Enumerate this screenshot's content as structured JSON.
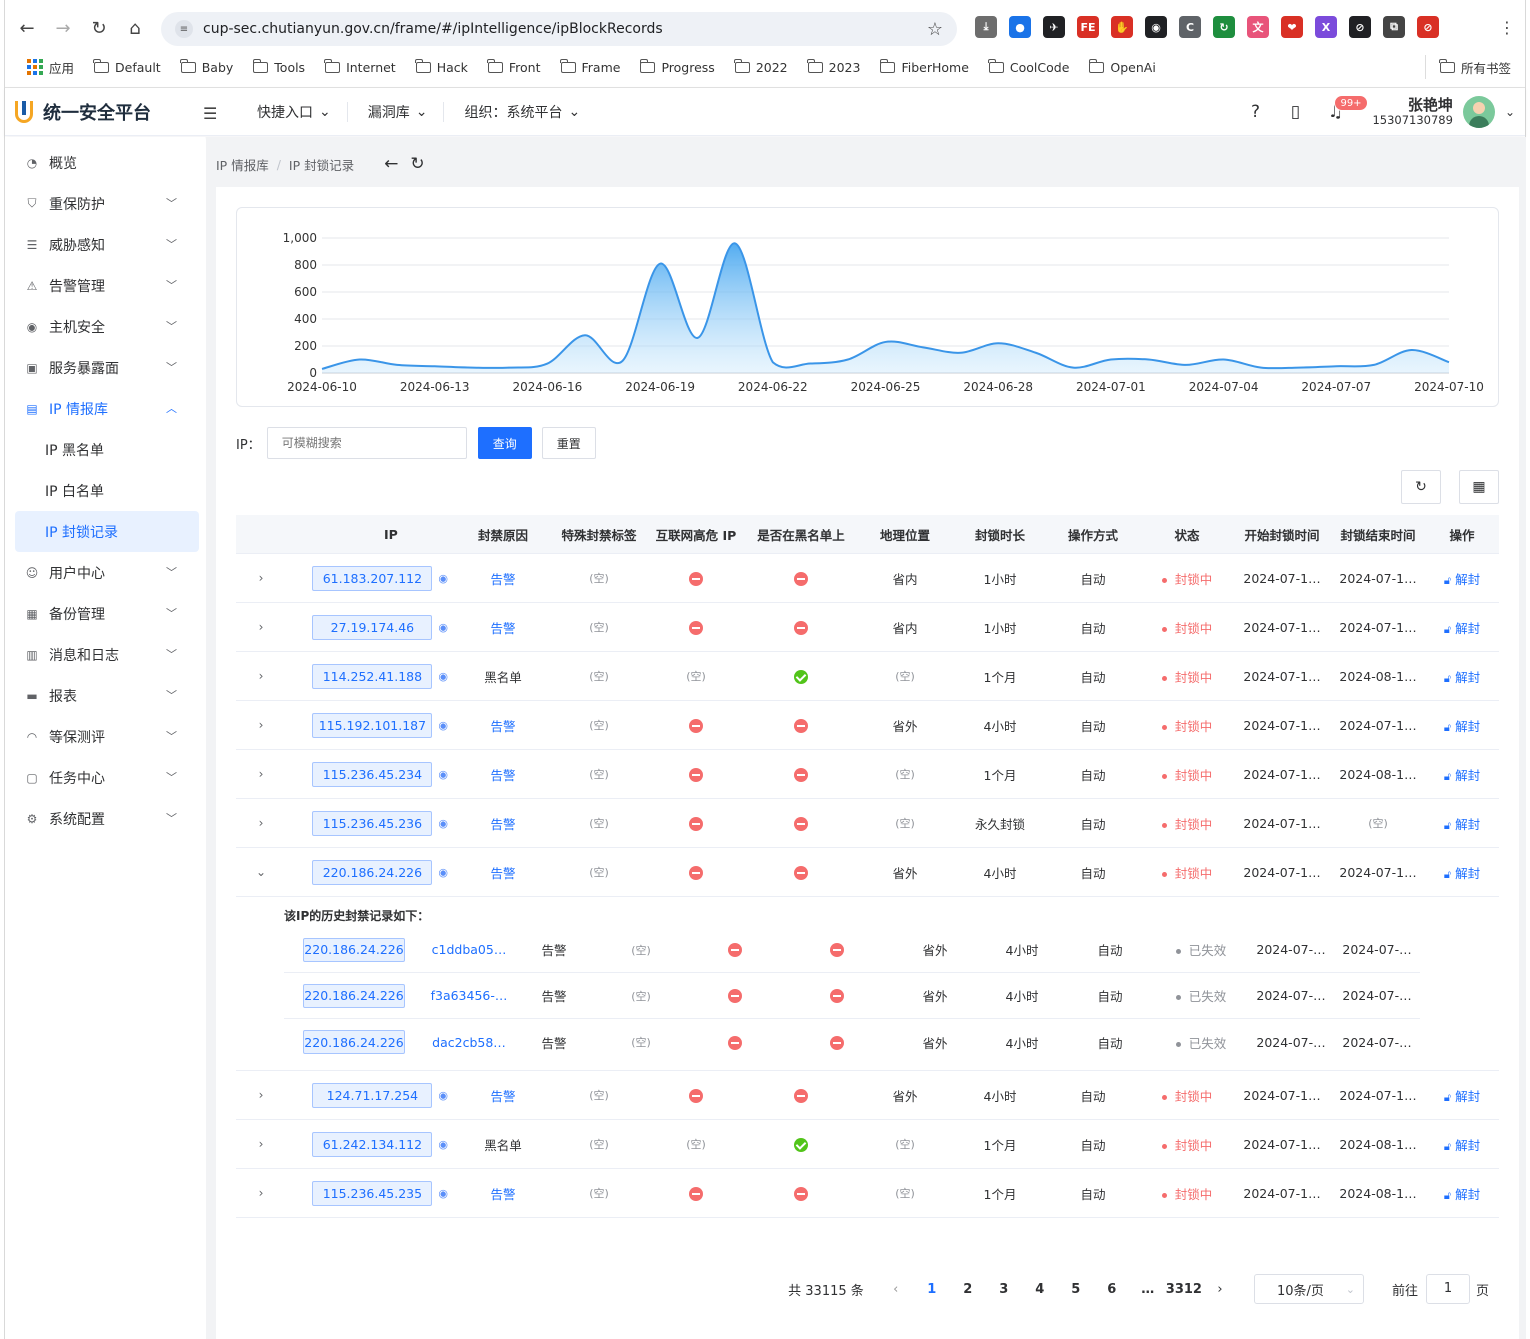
{
  "browser": {
    "url": "cup-sec.chutianyun.gov.cn/frame/#/ipIntelligence/ipBlockRecords",
    "apps_label": "应用",
    "bookmarks": [
      "Default",
      "Baby",
      "Tools",
      "Internet",
      "Hack",
      "Front",
      "Frame",
      "Progress",
      "2022",
      "2023",
      "FiberHome",
      "CoolCode",
      "OpenAi"
    ],
    "all_bookmarks": "所有书签",
    "extensions": [
      {
        "name": "download-icon",
        "glyph": "⤓",
        "color": "#6d6d6d"
      },
      {
        "name": "password-icon",
        "glyph": "●",
        "color": "#1a73e8"
      },
      {
        "name": "send-icon",
        "glyph": "✈",
        "color": "#202124"
      },
      {
        "name": "fe-icon",
        "glyph": "FE",
        "color": "#d93025"
      },
      {
        "name": "adblock-icon",
        "glyph": "✋",
        "color": "#d93025"
      },
      {
        "name": "incognito-icon",
        "glyph": "◉",
        "color": "#202124"
      },
      {
        "name": "c-icon",
        "glyph": "C",
        "color": "#5f6368"
      },
      {
        "name": "refresh-ext-icon",
        "glyph": "↻",
        "color": "#1e8e3e"
      },
      {
        "name": "translate-icon",
        "glyph": "文",
        "color": "#e8547a"
      },
      {
        "name": "pocket-icon",
        "glyph": "❤",
        "color": "#d93025"
      },
      {
        "name": "x-icon",
        "glyph": "X",
        "color": "#7b4bdb"
      },
      {
        "name": "block-icon",
        "glyph": "⊘",
        "color": "#202124"
      },
      {
        "name": "puzzle-icon",
        "glyph": "⧉",
        "color": "#444"
      },
      {
        "name": "no-entry-icon",
        "glyph": "⊘",
        "color": "#d93025"
      }
    ]
  },
  "app": {
    "title": "统一安全平台",
    "top_menu": [
      "快捷入口",
      "漏洞库",
      "组织：系统平台"
    ],
    "badge": "99+",
    "user_name": "张艳坤",
    "user_phone": "15307130789"
  },
  "sidebar": {
    "items": [
      {
        "label": "概览",
        "icon": "dashboard-icon",
        "glyph": "◔",
        "chevron": false
      },
      {
        "label": "重保防护",
        "icon": "shield-icon",
        "glyph": "⛉",
        "chevron": true
      },
      {
        "label": "威胁感知",
        "icon": "server-icon",
        "glyph": "☰",
        "chevron": true
      },
      {
        "label": "告警管理",
        "icon": "warning-icon",
        "glyph": "⚠",
        "chevron": true
      },
      {
        "label": "主机安全",
        "icon": "eye-icon",
        "glyph": "◉",
        "chevron": true
      },
      {
        "label": "服务暴露面",
        "icon": "box-icon",
        "glyph": "▣",
        "chevron": true
      },
      {
        "label": "IP 情报库",
        "icon": "ip-icon",
        "glyph": "▤",
        "chevron": true,
        "active": true,
        "children": [
          "IP 黑名单",
          "IP 白名单",
          "IP 封锁记录"
        ]
      },
      {
        "label": "用户中心",
        "icon": "user-icon",
        "glyph": "☺",
        "chevron": true
      },
      {
        "label": "备份管理",
        "icon": "backup-icon",
        "glyph": "▦",
        "chevron": true
      },
      {
        "label": "消息和日志",
        "icon": "log-icon",
        "glyph": "▥",
        "chevron": true
      },
      {
        "label": "报表",
        "icon": "report-icon",
        "glyph": "▬",
        "chevron": true
      },
      {
        "label": "等保测评",
        "icon": "gauge-icon",
        "glyph": "◠",
        "chevron": true
      },
      {
        "label": "任务中心",
        "icon": "task-icon",
        "glyph": "▢",
        "chevron": true
      },
      {
        "label": "系统配置",
        "icon": "gear-icon",
        "glyph": "⚙",
        "chevron": true
      }
    ]
  },
  "breadcrumb": [
    "IP 情报库",
    "IP 封锁记录"
  ],
  "chart_data": {
    "type": "area",
    "x": [
      "2024-06-10",
      "2024-06-11",
      "2024-06-12",
      "2024-06-13",
      "2024-06-14",
      "2024-06-15",
      "2024-06-16",
      "2024-06-17",
      "2024-06-18",
      "2024-06-19",
      "2024-06-20",
      "2024-06-21",
      "2024-06-22",
      "2024-06-23",
      "2024-06-24",
      "2024-06-25",
      "2024-06-26",
      "2024-06-27",
      "2024-06-28",
      "2024-06-29",
      "2024-06-30",
      "2024-07-01",
      "2024-07-02",
      "2024-07-03",
      "2024-07-04",
      "2024-07-05",
      "2024-07-06",
      "2024-07-07",
      "2024-07-08",
      "2024-07-09",
      "2024-07-10"
    ],
    "values": [
      30,
      100,
      60,
      50,
      40,
      40,
      70,
      280,
      90,
      810,
      260,
      960,
      80,
      70,
      100,
      230,
      190,
      150,
      220,
      150,
      40,
      100,
      100,
      60,
      100,
      40,
      40,
      50,
      60,
      170,
      80
    ],
    "xticks": [
      "2024-06-10",
      "2024-06-13",
      "2024-06-16",
      "2024-06-19",
      "2024-06-22",
      "2024-06-25",
      "2024-06-28",
      "2024-07-01",
      "2024-07-04",
      "2024-07-07",
      "2024-07-10"
    ],
    "yticks": [
      "0",
      "200",
      "400",
      "600",
      "800",
      "1,000"
    ],
    "ylim": [
      0,
      1000
    ],
    "grid": true
  },
  "search": {
    "label": "IP：",
    "placeholder": "可模糊搜索",
    "query": "查询",
    "reset": "重置"
  },
  "table": {
    "headers": [
      "IP",
      "封禁原因",
      "特殊封禁标签",
      "互联网高危 IP",
      "是否在黑名单上",
      "地理位置",
      "封锁时长",
      "操作方式",
      "状态",
      "开始封锁时间",
      "封锁结束时间",
      "操作"
    ],
    "empty": "(空)",
    "action": "解封",
    "rows": [
      {
        "ip": "61.183.207.112",
        "reason": "告警",
        "reason_link": true,
        "tag": "(空)",
        "risk": "stop",
        "black": "stop",
        "geo": "省内",
        "dur": "1小时",
        "mode": "自动",
        "status": "封锁中",
        "start": "2024-07-1…",
        "end": "2024-07-1…"
      },
      {
        "ip": "27.19.174.46",
        "reason": "告警",
        "reason_link": true,
        "tag": "(空)",
        "risk": "stop",
        "black": "stop",
        "geo": "省内",
        "dur": "1小时",
        "mode": "自动",
        "status": "封锁中",
        "start": "2024-07-1…",
        "end": "2024-07-1…"
      },
      {
        "ip": "114.252.41.188",
        "reason": "黑名单",
        "reason_link": false,
        "tag": "(空)",
        "risk": "empty",
        "black": "ok",
        "geo": "(空)",
        "dur": "1个月",
        "mode": "自动",
        "status": "封锁中",
        "start": "2024-07-1…",
        "end": "2024-08-1…"
      },
      {
        "ip": "115.192.101.187",
        "reason": "告警",
        "reason_link": true,
        "tag": "(空)",
        "risk": "stop",
        "black": "stop",
        "geo": "省外",
        "dur": "4小时",
        "mode": "自动",
        "status": "封锁中",
        "start": "2024-07-1…",
        "end": "2024-07-1…"
      },
      {
        "ip": "115.236.45.234",
        "reason": "告警",
        "reason_link": true,
        "tag": "(空)",
        "risk": "stop",
        "black": "stop",
        "geo": "(空)",
        "dur": "1个月",
        "mode": "自动",
        "status": "封锁中",
        "start": "2024-07-1…",
        "end": "2024-08-1…"
      },
      {
        "ip": "115.236.45.236",
        "reason": "告警",
        "reason_link": true,
        "tag": "(空)",
        "risk": "stop",
        "black": "stop",
        "geo": "(空)",
        "dur": "永久封锁",
        "mode": "自动",
        "status": "封锁中",
        "start": "2024-07-1…",
        "end": "(空)"
      },
      {
        "ip": "220.186.24.226",
        "reason": "告警",
        "reason_link": true,
        "tag": "(空)",
        "risk": "stop",
        "black": "stop",
        "geo": "省外",
        "dur": "4小时",
        "mode": "自动",
        "status": "封锁中",
        "start": "2024-07-1…",
        "end": "2024-07-1…",
        "expanded": true
      },
      {
        "ip": "124.71.17.254",
        "reason": "告警",
        "reason_link": true,
        "tag": "(空)",
        "risk": "stop",
        "black": "stop",
        "geo": "省外",
        "dur": "4小时",
        "mode": "自动",
        "status": "封锁中",
        "start": "2024-07-1…",
        "end": "2024-07-1…"
      },
      {
        "ip": "61.242.134.112",
        "reason": "黑名单",
        "reason_link": false,
        "tag": "(空)",
        "risk": "empty",
        "black": "ok",
        "geo": "(空)",
        "dur": "1个月",
        "mode": "自动",
        "status": "封锁中",
        "start": "2024-07-1…",
        "end": "2024-08-1…"
      },
      {
        "ip": "115.236.45.235",
        "reason": "告警",
        "reason_link": true,
        "tag": "(空)",
        "risk": "stop",
        "black": "stop",
        "geo": "(空)",
        "dur": "1个月",
        "mode": "自动",
        "status": "封锁中",
        "start": "2024-07-1…",
        "end": "2024-08-1…"
      }
    ],
    "history_title": "该IP的历史封禁记录如下：",
    "history": [
      {
        "ip": "220.186.24.226",
        "id": "c1ddba05…",
        "reason": "告警",
        "tag": "(空)",
        "geo": "省外",
        "dur": "4小时",
        "mode": "自动",
        "status": "已失效",
        "start": "2024-07-…",
        "end": "2024-07-…"
      },
      {
        "ip": "220.186.24.226",
        "id": "f3a63456-…",
        "reason": "告警",
        "tag": "(空)",
        "geo": "省外",
        "dur": "4小时",
        "mode": "自动",
        "status": "已失效",
        "start": "2024-07-…",
        "end": "2024-07-…"
      },
      {
        "ip": "220.186.24.226",
        "id": "dac2cb58…",
        "reason": "告警",
        "tag": "(空)",
        "geo": "省外",
        "dur": "4小时",
        "mode": "自动",
        "status": "已失效",
        "start": "2024-07-…",
        "end": "2024-07-…"
      }
    ]
  },
  "pagination": {
    "total": "共 33115 条",
    "pages": [
      "1",
      "2",
      "3",
      "4",
      "5",
      "6",
      "…",
      "3312"
    ],
    "current": "1",
    "page_size": "10条/页",
    "goto_prefix": "前往",
    "goto_value": "1",
    "goto_suffix": "页"
  }
}
